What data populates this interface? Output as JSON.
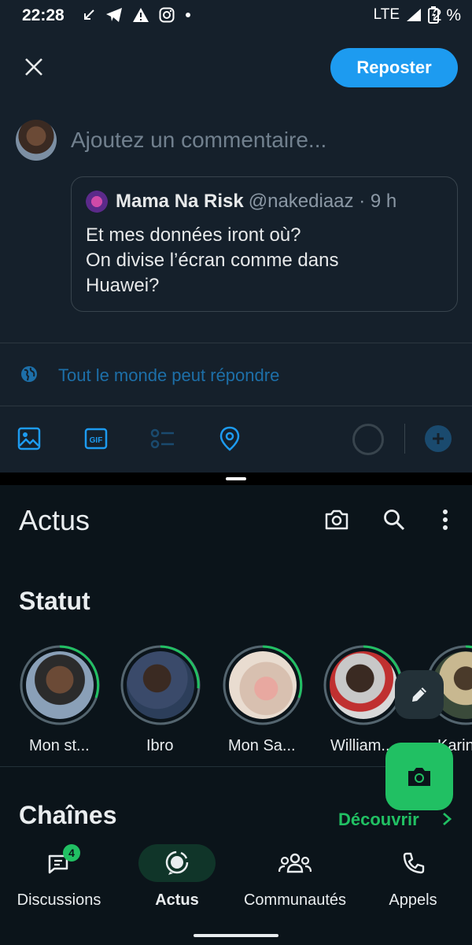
{
  "status_bar": {
    "time": "22:28",
    "network": "LTE",
    "battery": "2 %",
    "left_icons": [
      "missed-call-arrow-icon",
      "telegram-icon",
      "warning-icon",
      "instagram-icon",
      "dot-icon"
    ]
  },
  "repost": {
    "close_icon": "close-icon",
    "repost_label": "Reposter",
    "comment_placeholder": "Ajoutez un commentaire...",
    "quote": {
      "name": "Mama Na Risk",
      "handle": "@nakediaaz · 9 h",
      "text": "Et mes données iront où?\nOn divise l’écran comme dans\nHuawei?"
    },
    "reply_setting": "Tout le monde peut répondre",
    "toolbar": [
      "image-icon",
      "gif-icon",
      "poll-icon",
      "location-icon"
    ],
    "accent": "#1d9bf0"
  },
  "whatsapp": {
    "title": "Actus",
    "status_section": "Statut",
    "statuses": [
      {
        "label": "Mon st..."
      },
      {
        "label": "Ibro"
      },
      {
        "label": "Mon Sa..."
      },
      {
        "label": "William..."
      },
      {
        "label": "Karin"
      }
    ],
    "channels_title": "Chaînes",
    "discover_label": "Découvrir",
    "nav": [
      {
        "label": "Discussions",
        "badge": "4"
      },
      {
        "label": "Actus"
      },
      {
        "label": "Communautés"
      },
      {
        "label": "Appels"
      }
    ],
    "accent": "#21c063"
  }
}
